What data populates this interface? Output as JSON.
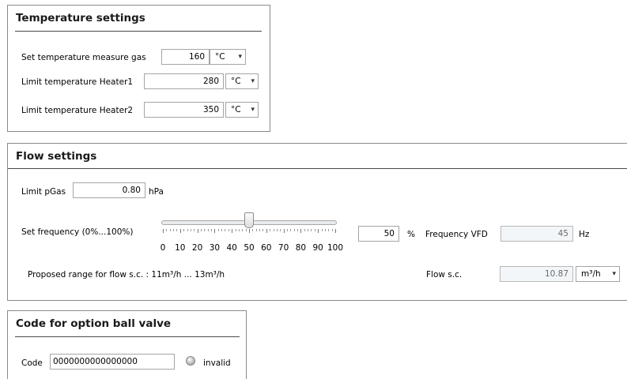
{
  "temperature": {
    "title": "Temperature settings",
    "rows": [
      {
        "label": "Set temperature measure gas",
        "value": "160",
        "unit": "°C"
      },
      {
        "label": "Limit temperature Heater1",
        "value": "280",
        "unit": "°C"
      },
      {
        "label": "Limit temperature Heater2",
        "value": "350",
        "unit": "°C"
      }
    ]
  },
  "flow": {
    "title": "Flow settings",
    "limit_pgas_label": "Limit pGas",
    "limit_pgas_value": "0.80",
    "limit_pgas_unit": "hPa",
    "set_frequency_label": "Set frequency (0%...100%)",
    "slider_value_pct": 50,
    "slider_scale": [
      "0",
      "10",
      "20",
      "30",
      "40",
      "50",
      "60",
      "70",
      "80",
      "90",
      "100"
    ],
    "set_frequency_value": "50",
    "set_frequency_unit": "%",
    "frequency_vfd_label": "Frequency VFD",
    "frequency_vfd_value": "45",
    "frequency_vfd_unit": "Hz",
    "proposed_range_text": "Proposed range for flow s.c. : 11m³/h ... 13m³/h",
    "flow_sc_label": "Flow s.c.",
    "flow_sc_value": "10.87",
    "flow_sc_unit": "m³/h"
  },
  "ball_valve": {
    "title": "Code for option ball valve",
    "code_label": "Code",
    "code_value": "0000000000000000",
    "status_text": "invalid"
  },
  "icons": {
    "dropdown": "chevron-down-icon",
    "status": "status-led-icon"
  }
}
